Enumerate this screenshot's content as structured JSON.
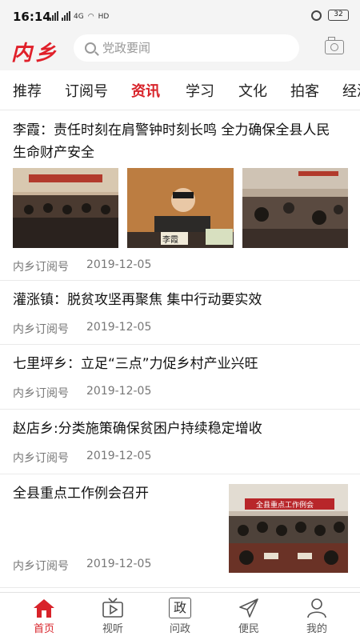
{
  "status_bar": {
    "time": "16:14",
    "signal_label": "4G",
    "data_label": "HD",
    "battery": "32"
  },
  "header": {
    "logo": "内乡",
    "search_placeholder": "党政要闻"
  },
  "tabs": [
    "推荐",
    "订阅号",
    "资讯",
    "学习",
    "文化",
    "拍客",
    "经济"
  ],
  "active_tab": "资讯",
  "feed": [
    {
      "title_lines": [
        "李霞：责任时刻在肩警钟时刻长鸣 全力确保全县人民",
        "生命财产安全"
      ],
      "source": "内乡订阅号",
      "date": "2019-12-05",
      "images": [
        "meeting-hall-photo",
        "speaker-photo",
        "audience-photo"
      ],
      "name_plate": "李霞"
    },
    {
      "title": "灌涨镇：脱贫攻坚再聚焦 集中行动要实效",
      "source": "内乡订阅号",
      "date": "2019-12-05"
    },
    {
      "title": "七里坪乡：立足“三点”力促乡村产业兴旺",
      "source": "内乡订阅号",
      "date": "2019-12-05"
    },
    {
      "title": "赵店乡:分类施策确保贫困户持续稳定增收",
      "source": "内乡订阅号",
      "date": "2019-12-05"
    },
    {
      "title": "全县重点工作例会召开",
      "source": "内乡订阅号",
      "date": "2019-12-05",
      "banner_text": "全县重点工作例会"
    }
  ],
  "bottom_nav": [
    {
      "label": "首页",
      "icon": "home-icon",
      "active": true
    },
    {
      "label": "视听",
      "icon": "tv-icon",
      "active": false
    },
    {
      "label": "问政",
      "icon": "politics-icon",
      "icon_text": "政",
      "active": false
    },
    {
      "label": "便民",
      "icon": "send-icon",
      "active": false
    },
    {
      "label": "我的",
      "icon": "person-icon",
      "active": false
    }
  ],
  "colors": {
    "accent": "#d8232a",
    "logo": "#e0202a"
  }
}
